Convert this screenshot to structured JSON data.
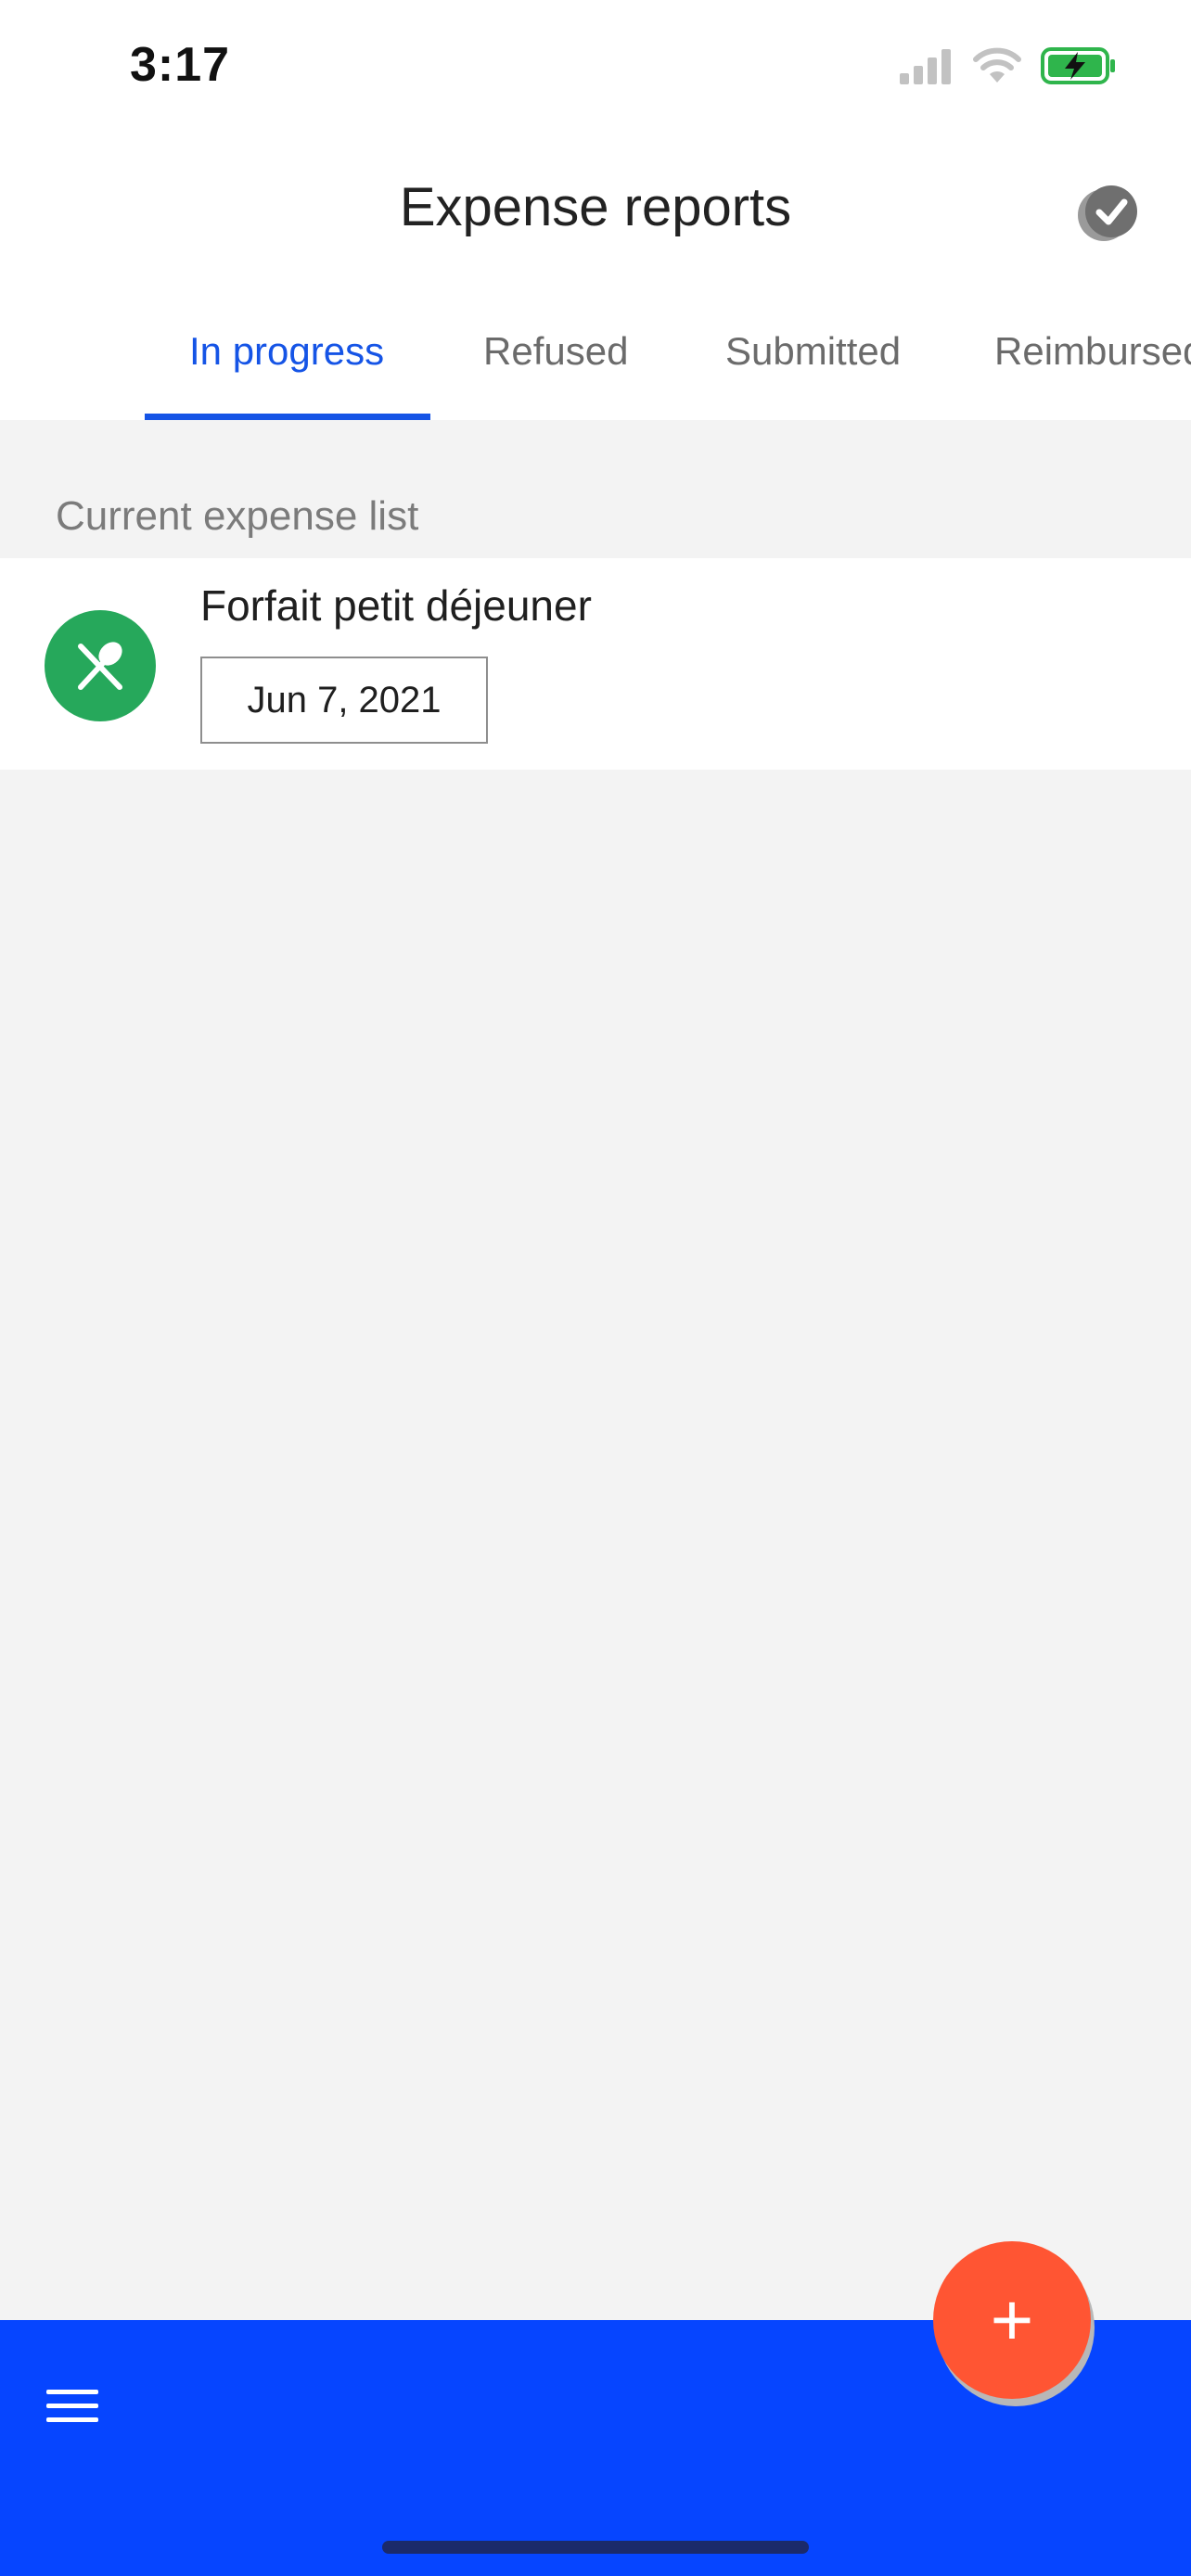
{
  "status_bar": {
    "time": "3:17",
    "signal_icon": "signal-icon",
    "wifi_icon": "wifi-icon",
    "battery_icon": "battery-charging-icon"
  },
  "header": {
    "title": "Expense reports",
    "action_icon": "check-circle-icon"
  },
  "tabs": [
    {
      "label": "In progress",
      "active": true
    },
    {
      "label": "Refused",
      "active": false
    },
    {
      "label": "Submitted",
      "active": false
    },
    {
      "label": "Reimbursed",
      "active": false
    }
  ],
  "section": {
    "heading": "Current expense list"
  },
  "expenses": [
    {
      "title": "Forfait petit déjeuner",
      "date": "Jun 7, 2021",
      "icon": "restaurant-icon",
      "icon_color": "#26a85b"
    }
  ],
  "fab": {
    "label": "+",
    "icon": "plus-icon"
  },
  "bottom_bar": {
    "menu_icon": "menu-icon"
  },
  "colors": {
    "accent": "#1554e6",
    "bottom_bar": "#0645ff",
    "fab": "#ff5533",
    "expense_icon": "#26a85b"
  }
}
